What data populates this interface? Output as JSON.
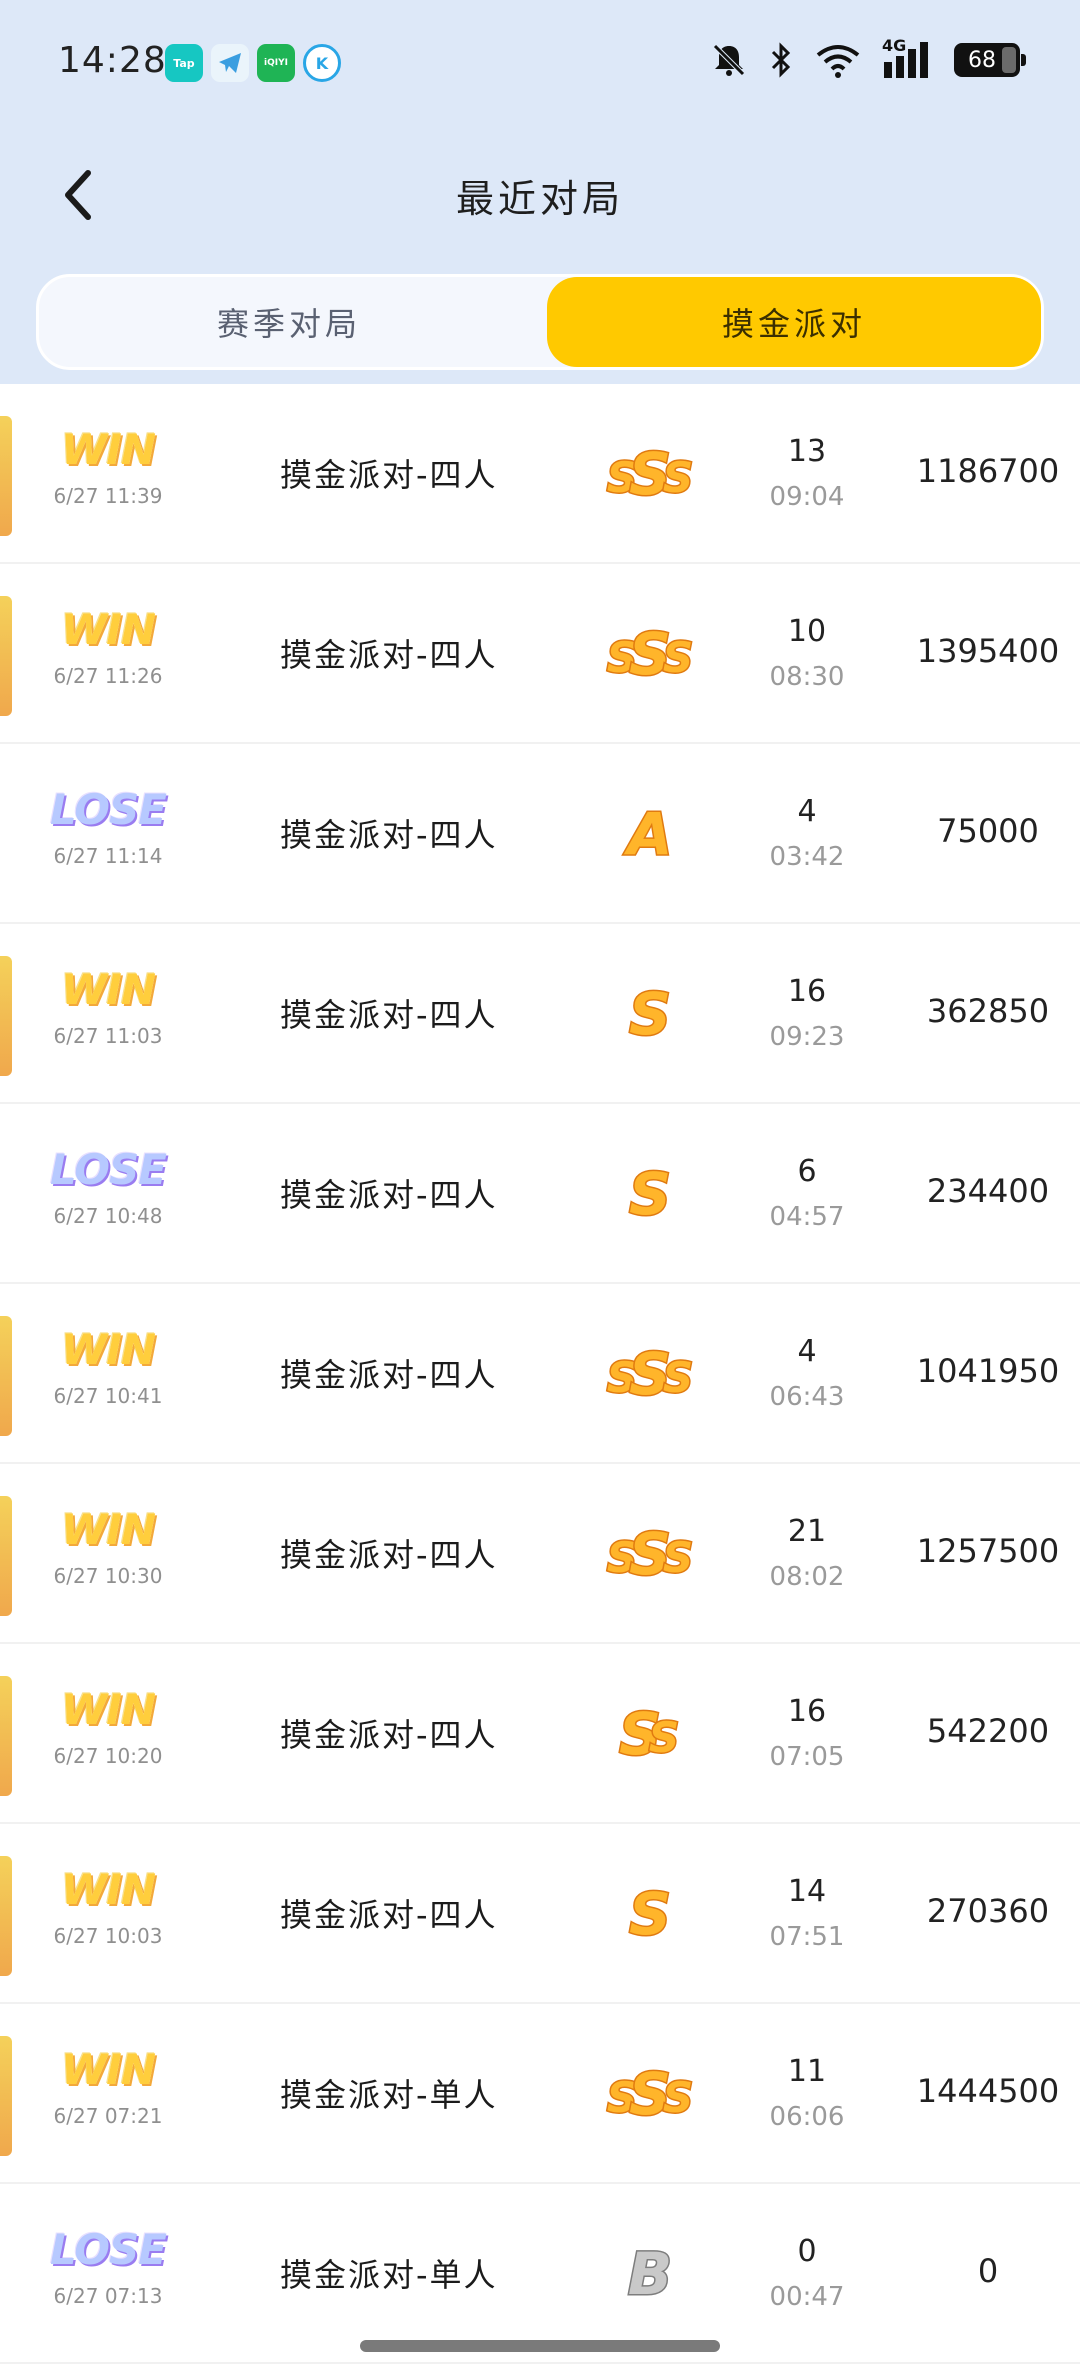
{
  "status_bar": {
    "time": "14:28",
    "app_icons": [
      {
        "name": "taptap-icon",
        "label": "Tap",
        "color": "#16c7c2"
      },
      {
        "name": "telegram-icon",
        "label": "",
        "color": "#5ab0e6"
      },
      {
        "name": "iqiyi-icon",
        "label": "iQIYI",
        "color": "#1fb455"
      },
      {
        "name": "kugou-icon",
        "label": "K",
        "color": "#29a6e6"
      }
    ],
    "network": "4G",
    "battery": "68"
  },
  "header": {
    "title": "最近对局"
  },
  "tabs": [
    {
      "label": "赛季对局",
      "selected": false
    },
    {
      "label": "摸金派对",
      "selected": true
    }
  ],
  "colors": {
    "accent": "#ffc900",
    "top_bg": "#dde8f8",
    "win": "#ffce3d",
    "lose": "#b7c9ff"
  },
  "matches": [
    {
      "result": "WIN",
      "date": "6/27 11:39",
      "mode": "摸金派对-四人",
      "grade": "SSS",
      "rank": "13",
      "duration": "09:04",
      "score": "1186700"
    },
    {
      "result": "WIN",
      "date": "6/27 11:26",
      "mode": "摸金派对-四人",
      "grade": "SSS",
      "rank": "10",
      "duration": "08:30",
      "score": "1395400"
    },
    {
      "result": "LOSE",
      "date": "6/27 11:14",
      "mode": "摸金派对-四人",
      "grade": "A",
      "rank": "4",
      "duration": "03:42",
      "score": "75000"
    },
    {
      "result": "WIN",
      "date": "6/27 11:03",
      "mode": "摸金派对-四人",
      "grade": "S",
      "rank": "16",
      "duration": "09:23",
      "score": "362850"
    },
    {
      "result": "LOSE",
      "date": "6/27 10:48",
      "mode": "摸金派对-四人",
      "grade": "S",
      "rank": "6",
      "duration": "04:57",
      "score": "234400"
    },
    {
      "result": "WIN",
      "date": "6/27 10:41",
      "mode": "摸金派对-四人",
      "grade": "SSS",
      "rank": "4",
      "duration": "06:43",
      "score": "1041950"
    },
    {
      "result": "WIN",
      "date": "6/27 10:30",
      "mode": "摸金派对-四人",
      "grade": "SSS",
      "rank": "21",
      "duration": "08:02",
      "score": "1257500"
    },
    {
      "result": "WIN",
      "date": "6/27 10:20",
      "mode": "摸金派对-四人",
      "grade": "SS",
      "rank": "16",
      "duration": "07:05",
      "score": "542200"
    },
    {
      "result": "WIN",
      "date": "6/27 10:03",
      "mode": "摸金派对-四人",
      "grade": "S",
      "rank": "14",
      "duration": "07:51",
      "score": "270360"
    },
    {
      "result": "WIN",
      "date": "6/27 07:21",
      "mode": "摸金派对-单人",
      "grade": "SSS",
      "rank": "11",
      "duration": "06:06",
      "score": "1444500"
    },
    {
      "result": "LOSE",
      "date": "6/27 07:13",
      "mode": "摸金派对-单人",
      "grade": "B",
      "rank": "0",
      "duration": "00:47",
      "score": "0"
    }
  ]
}
